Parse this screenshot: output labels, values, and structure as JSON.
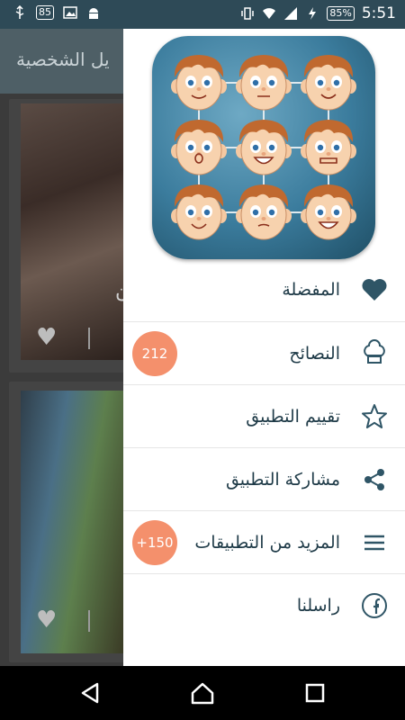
{
  "status_bar": {
    "left_icons": [
      "usb-icon",
      "battery-saver-icon",
      "image-icon",
      "android-icon"
    ],
    "left_badge": "85",
    "battery_percent": "85%",
    "time": "5:51"
  },
  "background_app": {
    "toolbar_title": "يل الشخصية",
    "card_caption_fragment": "ن"
  },
  "drawer": {
    "items": [
      {
        "label": "المفضلة",
        "icon": "heart-icon",
        "badge": ""
      },
      {
        "label": "النصائح",
        "icon": "chef-hat-icon",
        "badge": "212"
      },
      {
        "label": "تقييم التطبيق",
        "icon": "star-icon",
        "badge": ""
      },
      {
        "label": "مشاركة التطبيق",
        "icon": "share-icon",
        "badge": ""
      },
      {
        "label": "المزيد من التطبيقات",
        "icon": "menu-icon",
        "badge": "+150"
      },
      {
        "label": "راسلنا",
        "icon": "facebook-icon",
        "badge": ""
      }
    ]
  },
  "colors": {
    "drawer_text": "#1f3b48",
    "badge": "#f4906c",
    "status_bar": "#2e4a57"
  }
}
